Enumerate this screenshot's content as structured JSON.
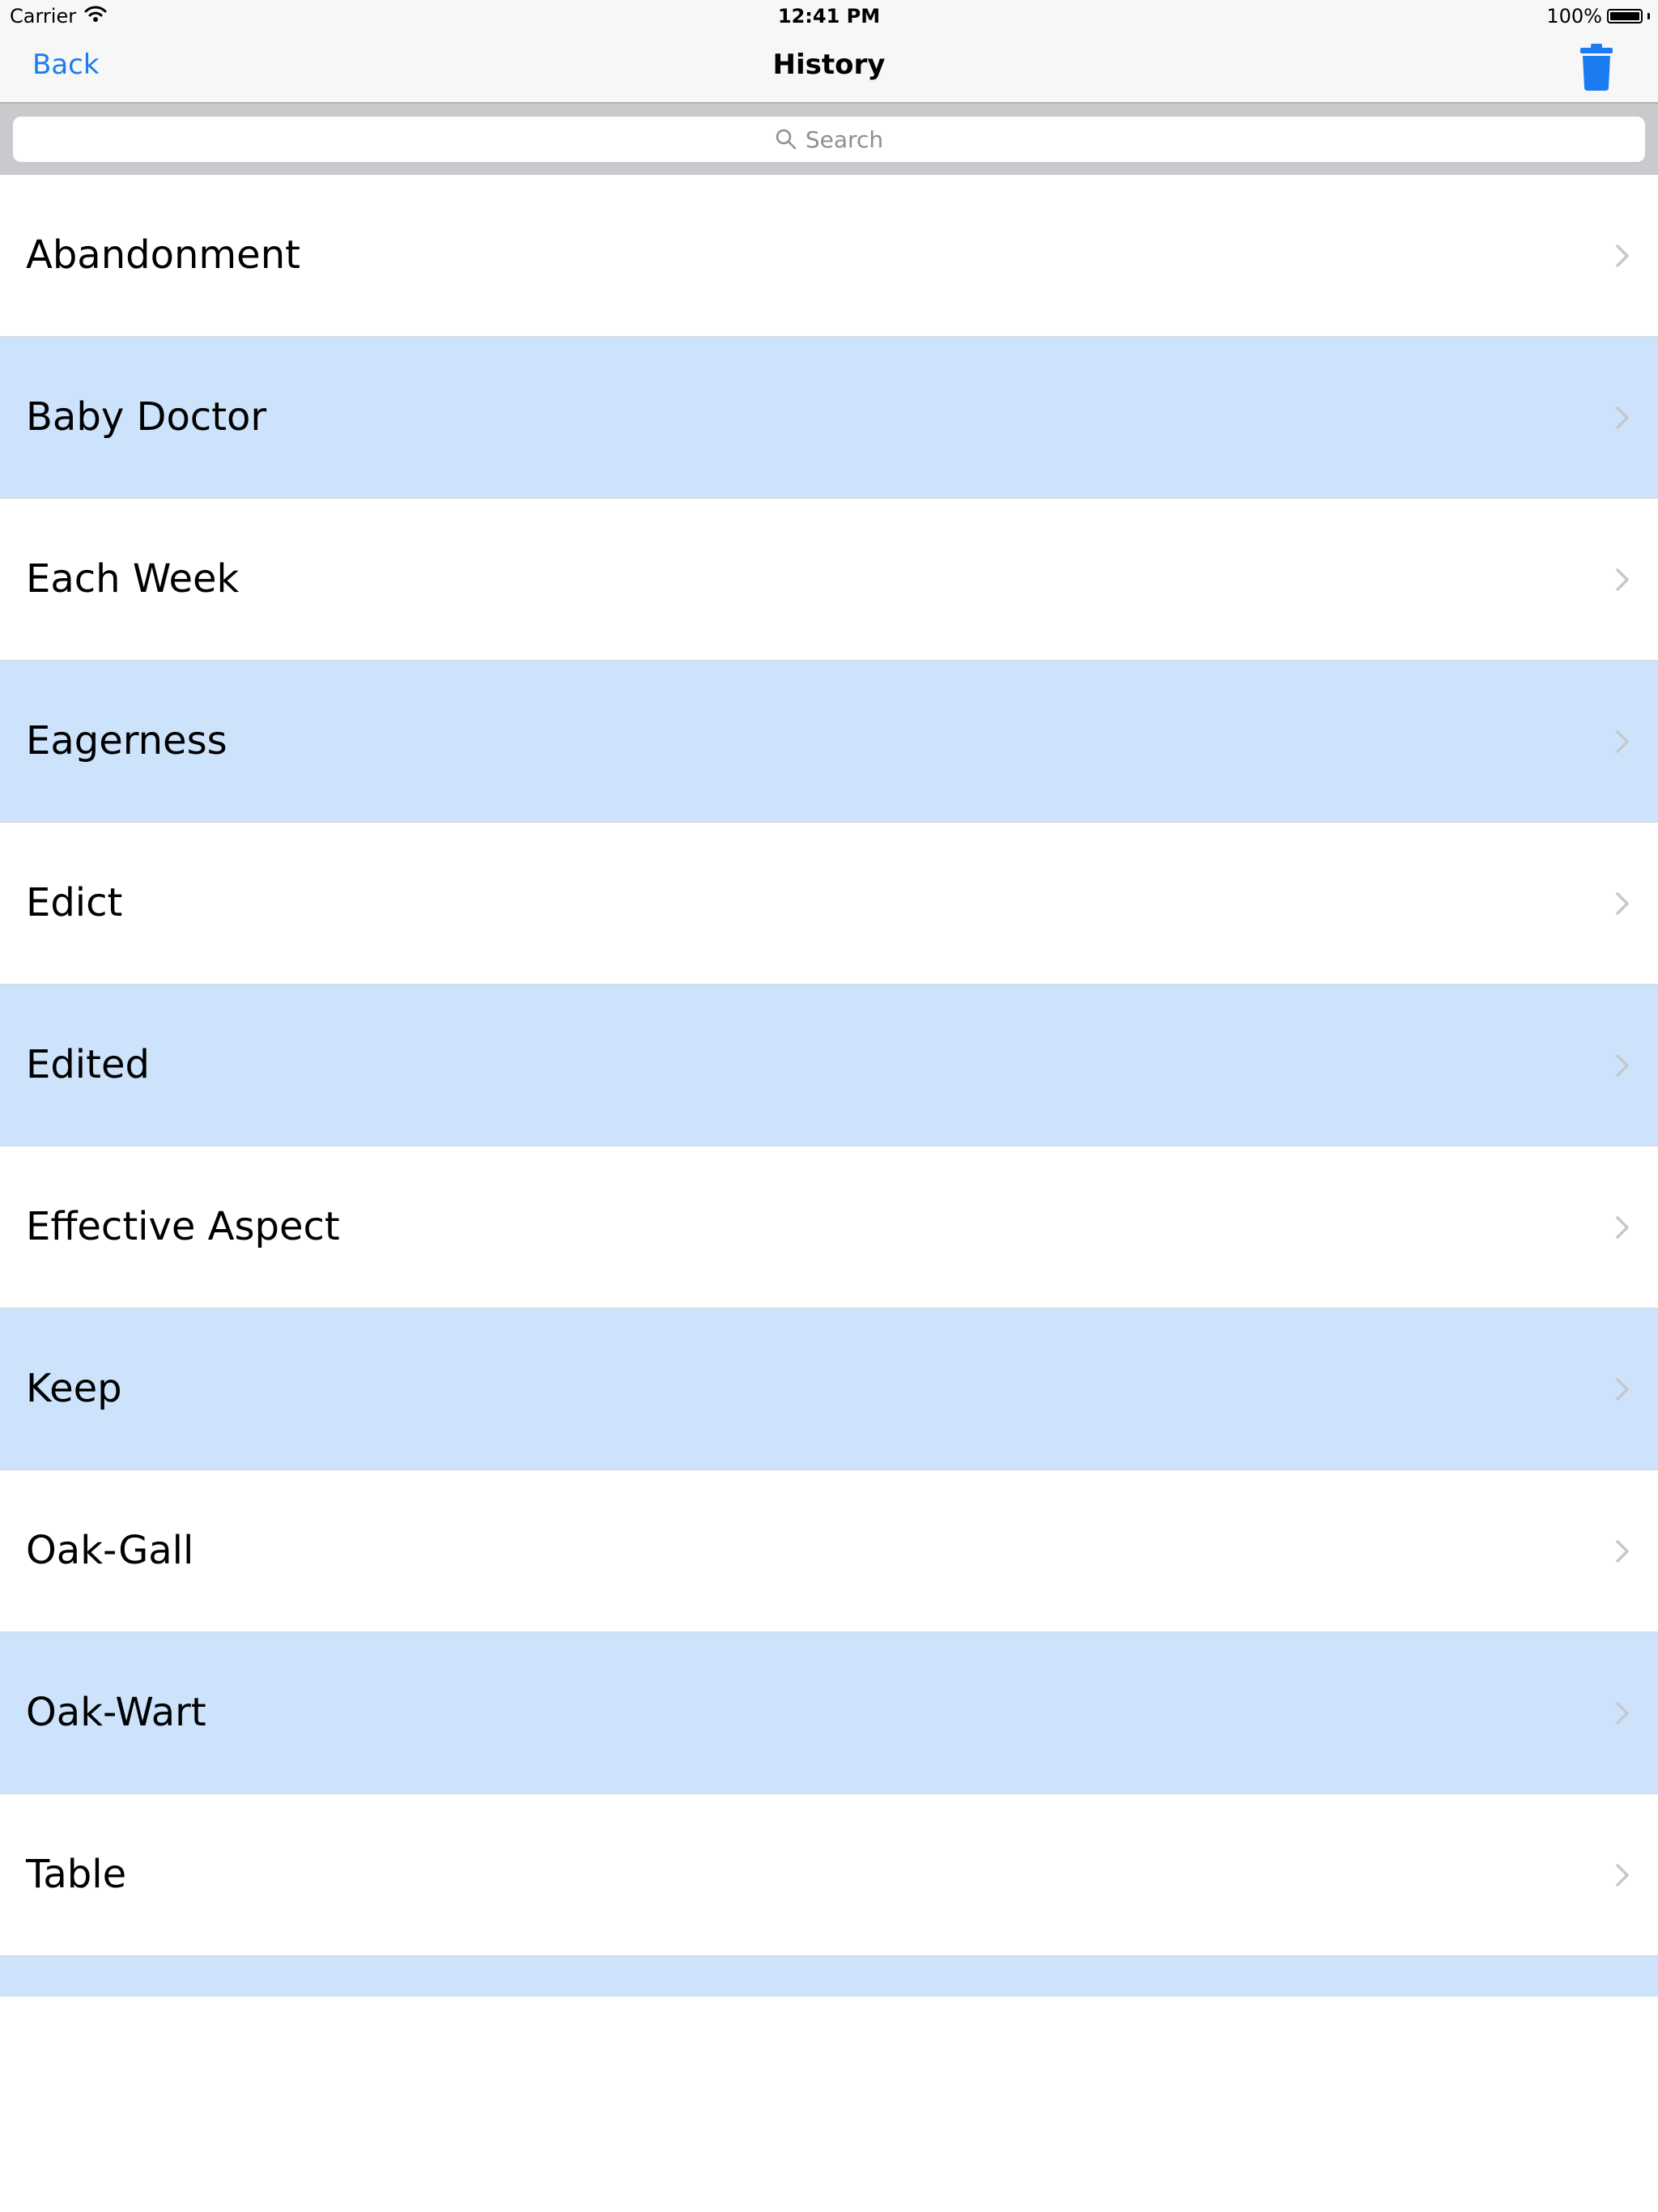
{
  "status_bar": {
    "carrier": "Carrier",
    "time": "12:41 PM",
    "battery_text": "100%",
    "battery_level": 1.0
  },
  "nav": {
    "back_label": "Back",
    "title": "History",
    "trash_icon": "trash-icon",
    "accent_color": "#1a7cf0"
  },
  "search": {
    "placeholder": "Search"
  },
  "history": {
    "row_color_alt": "#cce3fb",
    "items": [
      {
        "label": "Abandonment"
      },
      {
        "label": "Baby Doctor"
      },
      {
        "label": "Each Week"
      },
      {
        "label": "Eagerness"
      },
      {
        "label": "Edict"
      },
      {
        "label": "Edited"
      },
      {
        "label": "Effective Aspect"
      },
      {
        "label": "Keep"
      },
      {
        "label": "Oak-Gall"
      },
      {
        "label": "Oak-Wart"
      },
      {
        "label": "Table"
      }
    ]
  }
}
